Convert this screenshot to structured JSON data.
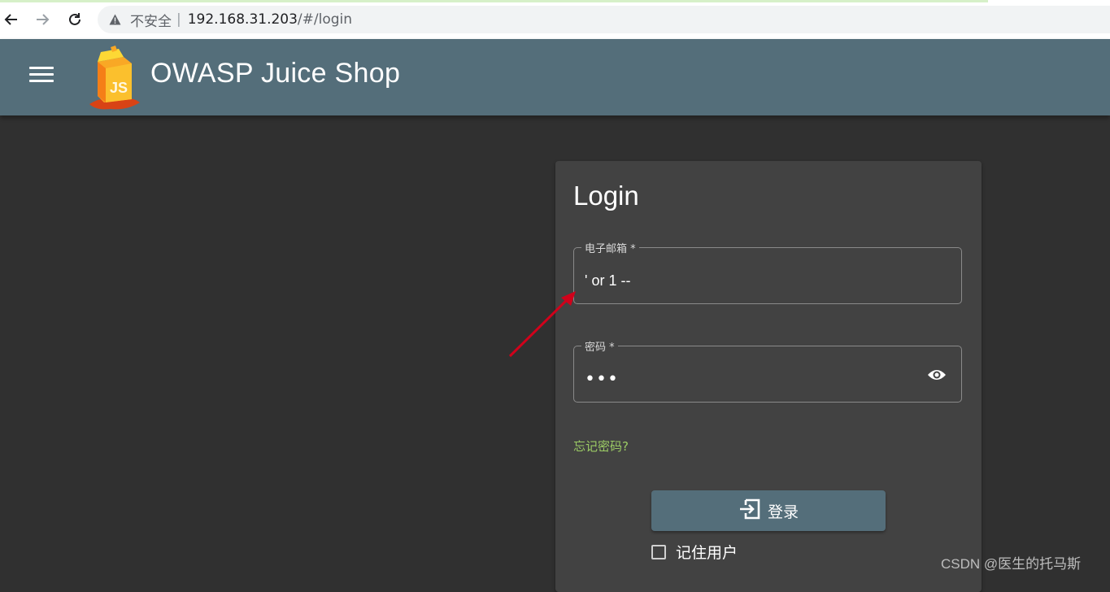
{
  "browser": {
    "security_label": "不安全",
    "separator": "|",
    "url_host": "192.168.31.203",
    "url_path": "/#/login",
    "icons": [
      "back-arrow-icon",
      "forward-arrow-icon",
      "reload-icon",
      "warning-triangle-icon"
    ]
  },
  "toolbar": {
    "title": "OWASP Juice Shop",
    "background": "#546e7a",
    "icons": [
      "hamburger-menu-icon",
      "juice-shop-logo"
    ]
  },
  "login": {
    "title": "Login",
    "email": {
      "label": "电子邮箱 *",
      "value": "' or 1 --"
    },
    "password": {
      "label": "密码 *",
      "masked_value": "•••"
    },
    "forgot_password": "忘记密码?",
    "submit_label": "登录",
    "remember_me": {
      "label": "记住用户",
      "checked": false
    }
  },
  "colors": {
    "page_background": "#303030",
    "card_background": "#424242",
    "accent_green": "#9ccc65",
    "annotation_arrow": "#d0021b"
  },
  "watermark": "CSDN @医生的托马斯"
}
